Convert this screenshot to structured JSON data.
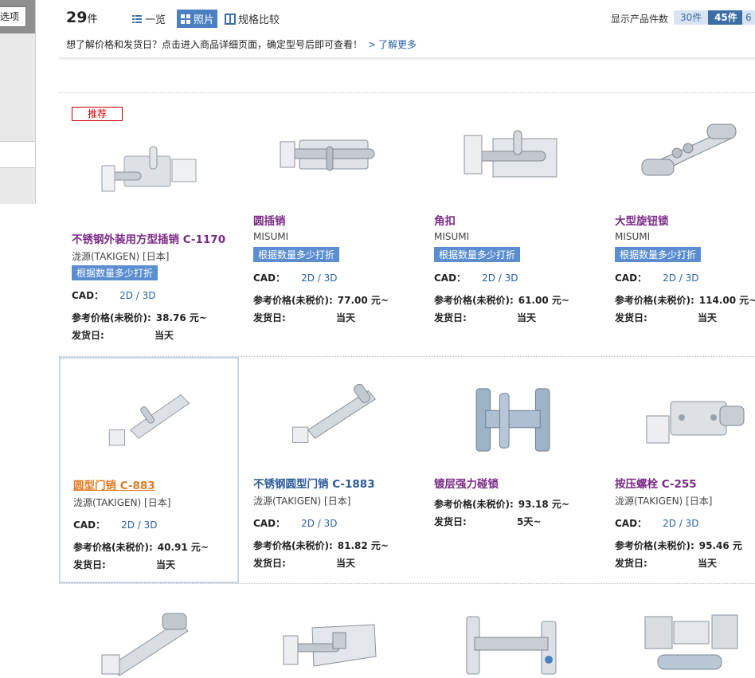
{
  "sidebar": {
    "options_label": "选项"
  },
  "header": {
    "count": "29",
    "count_unit": "件",
    "views": [
      "一览",
      "照片",
      "规格比较"
    ],
    "perpage_label": "显示产品件数",
    "perpage": [
      "30件",
      "45件",
      "6"
    ],
    "hint": "想了解价格和发货日？点击进入商品详细页面，确定型号后即可查看！",
    "learn_more": "了解更多"
  },
  "labels": {
    "badge": "推荐",
    "discount": "根据数量多少打折",
    "cad": "CAD：",
    "cad_link": "2D / 3D",
    "price": "参考价格(未税价):",
    "ship": "发货日:"
  },
  "products": [
    {
      "title": "不锈钢外装用方型插销 C-1170",
      "maker": "泷源(TAKIGEN) [日本]",
      "price": "38.76 元~",
      "ship": "当天"
    },
    {
      "title": "圆插销",
      "maker": "MISUMI",
      "price": "77.00 元~",
      "ship": "当天"
    },
    {
      "title": "角扣",
      "maker": "MISUMI",
      "price": "61.00 元~",
      "ship": "当天"
    },
    {
      "title": "大型旋钮锁",
      "maker": "MISUMI",
      "price": "114.00 元~",
      "ship": "当天"
    },
    {
      "title": "圆型门销 C-883",
      "maker": "泷源(TAKIGEN) [日本]",
      "price": "40.91 元~",
      "ship": "当天"
    },
    {
      "title": "不锈钢圆型门销 C-1883",
      "maker": "泷源(TAKIGEN) [日本]",
      "price": "81.82 元~",
      "ship": "当天"
    },
    {
      "title": "镀层强力碰锁",
      "maker": "",
      "price": "93.18 元~",
      "ship": "5天~"
    },
    {
      "title": "按压螺栓 C-255",
      "maker": "泷源(TAKIGEN) [日本]",
      "price": "95.46 元",
      "ship": "当天"
    }
  ]
}
